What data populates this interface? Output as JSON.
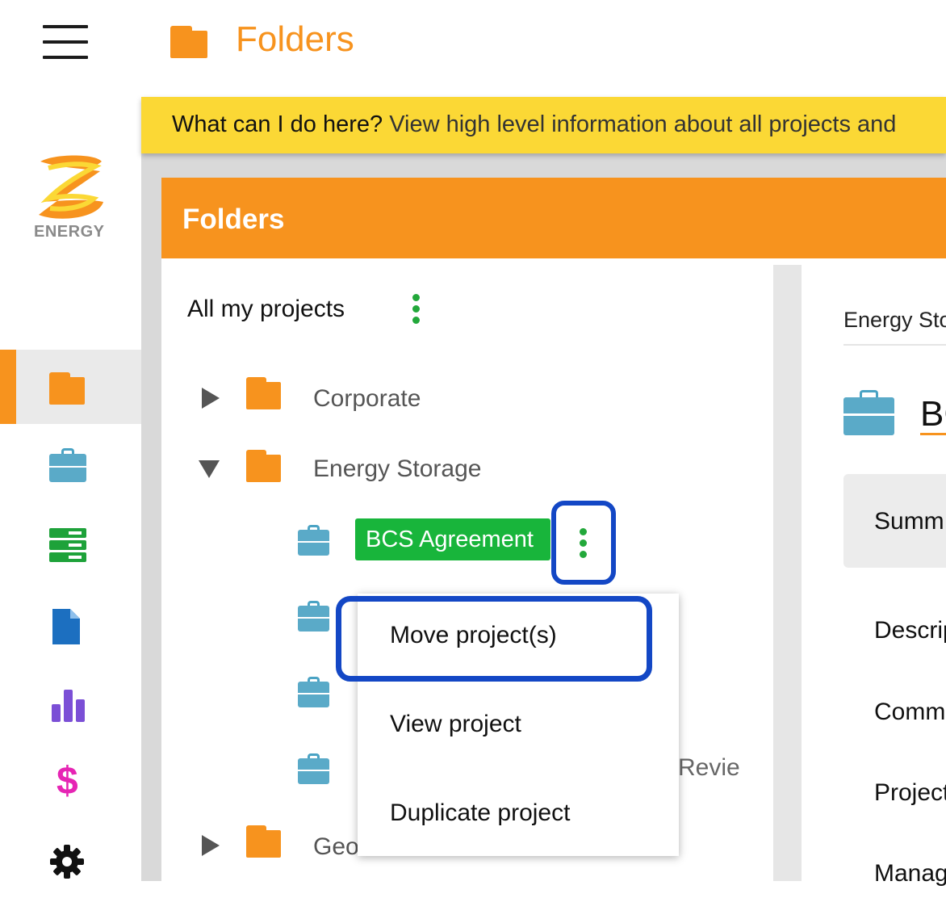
{
  "header": {
    "title": "Folders",
    "icon": "folder-icon"
  },
  "colors": {
    "orange": "#f7931e",
    "banner": "#fbd835",
    "green": "#18b53b",
    "highlight": "#1347c5",
    "briefcase": "#5aaac8"
  },
  "sidebar": {
    "logo_text": "ENERGY",
    "items": [
      {
        "icon": "folder-icon",
        "active": true
      },
      {
        "icon": "briefcase-icon"
      },
      {
        "icon": "server-icon"
      },
      {
        "icon": "document-icon"
      },
      {
        "icon": "bar-chart-icon"
      },
      {
        "icon": "dollar-icon",
        "glyph": "$"
      },
      {
        "icon": "gear-icon"
      }
    ]
  },
  "banner": {
    "question": "What can I do here?",
    "text": " View high level information about all projects and"
  },
  "panel": {
    "title": "Folders",
    "root_label": "All my projects",
    "tree": {
      "folders": [
        "Corporate",
        "Energy Storage",
        "Geo"
      ],
      "selected_project": "BCS Agreement",
      "partial_text": "Revie"
    }
  },
  "context_menu": {
    "items": [
      "Move project(s)",
      "View project",
      "Duplicate project"
    ]
  },
  "detail": {
    "breadcrumb": "Energy Sto",
    "heading": "BC",
    "tabs_visible": "Summ",
    "fields": [
      "Descrip",
      "Comm",
      "Project",
      "Manag"
    ]
  }
}
